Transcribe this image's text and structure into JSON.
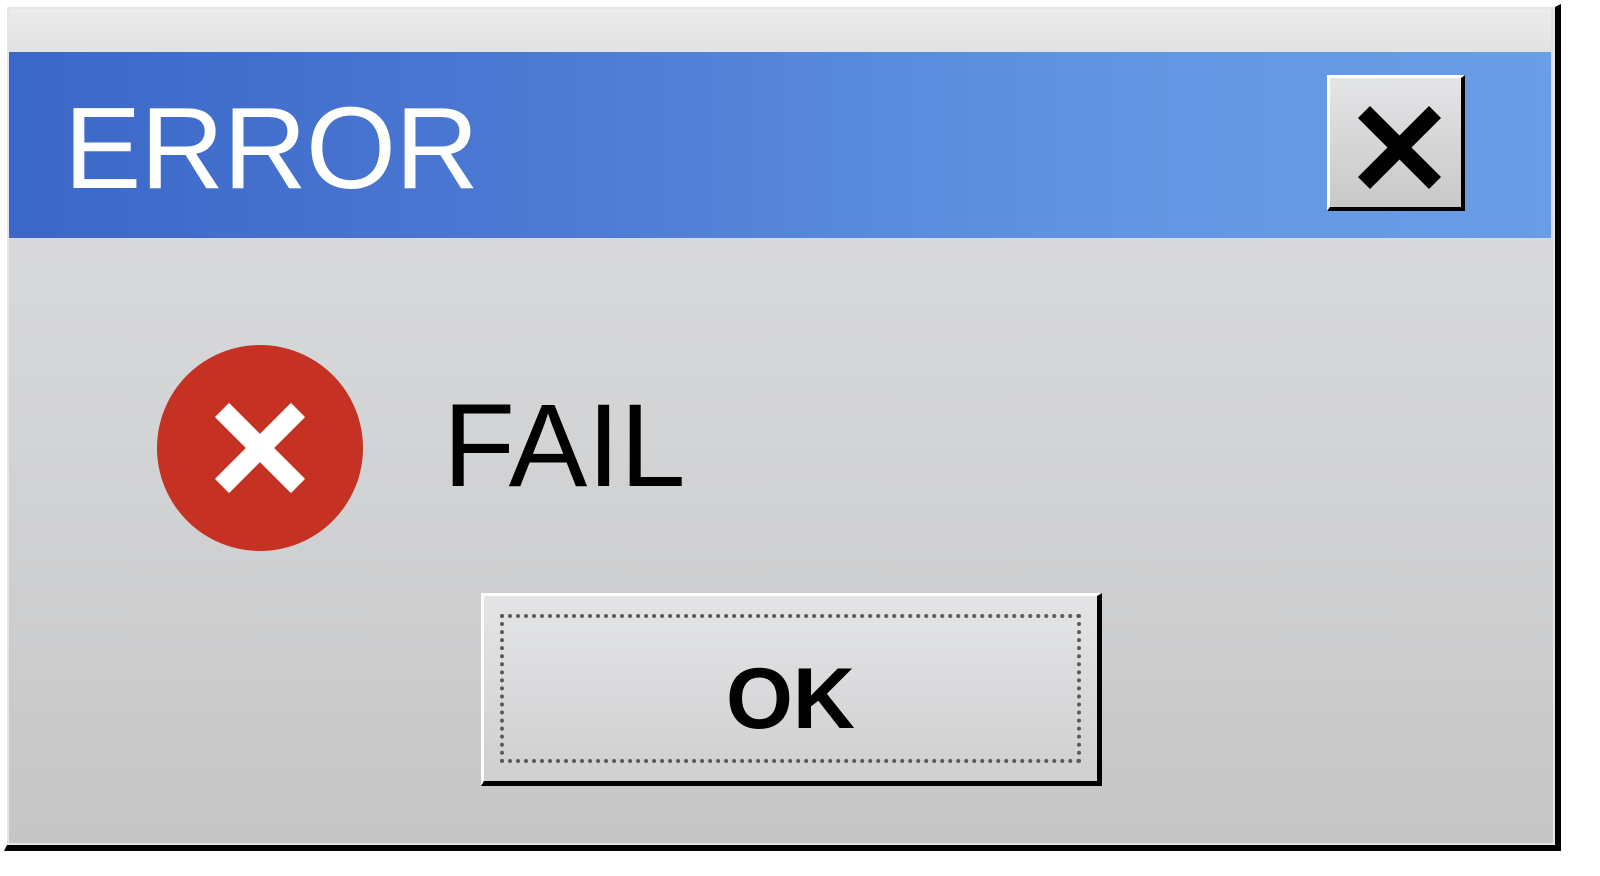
{
  "dialog": {
    "title": "ERROR",
    "message": "FAIL",
    "ok_label": "OK",
    "close_icon": "close-icon",
    "status_icon": "error-icon"
  },
  "colors": {
    "titlebar_start": "#3b67c8",
    "titlebar_end": "#6b9de6",
    "error_red": "#c53224",
    "window_gray": "#d3d4d6"
  }
}
